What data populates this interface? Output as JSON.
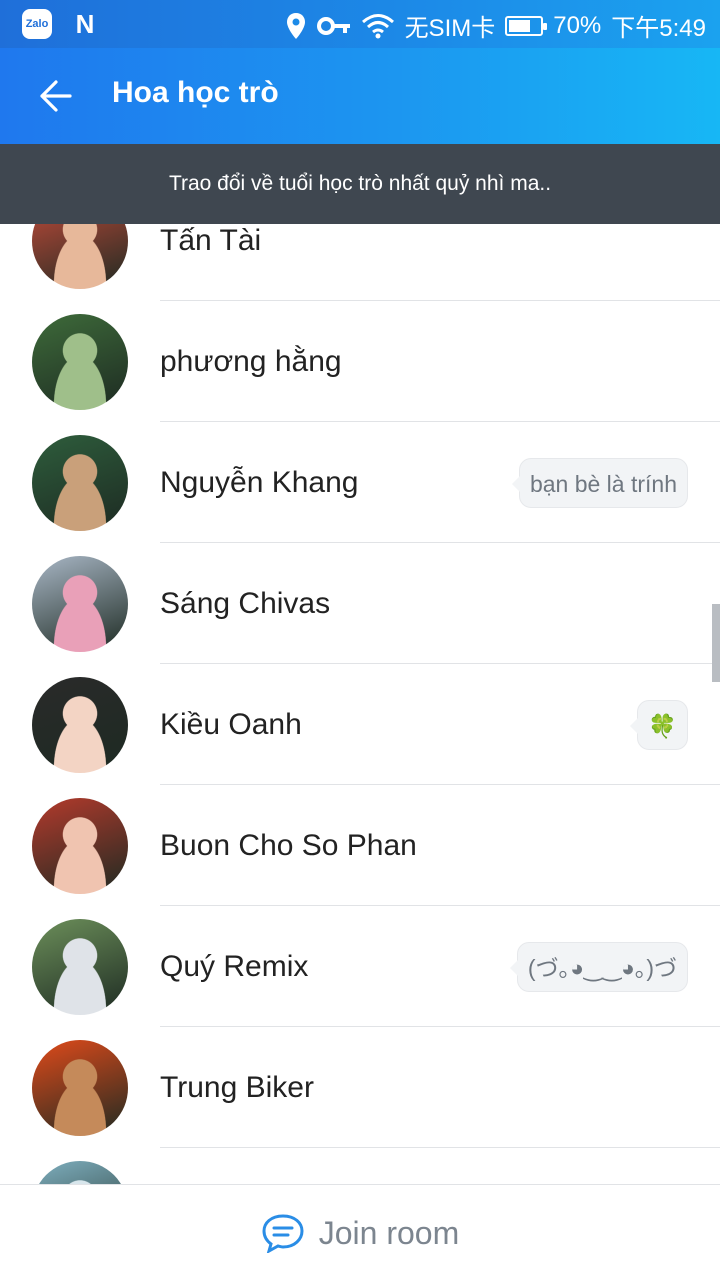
{
  "status_bar": {
    "left_icons": [
      "zalo-icon",
      "n-icon"
    ],
    "zalo_label": "Zalo",
    "n_label": "N",
    "sim": "无SIM卡",
    "battery": "70%",
    "battery_level": 0.7,
    "time": "下午5:49"
  },
  "header": {
    "title": "Hoa học trò",
    "back_icon": "arrow-left-icon"
  },
  "banner": {
    "text": "Trao đổi về tuổi học trò nhất quỷ nhì ma.."
  },
  "members": [
    {
      "name": "Tấn Tài",
      "status": ""
    },
    {
      "name": "phương hằng",
      "status": ""
    },
    {
      "name": "Nguyễn Khang",
      "status": "bạn bè là trính"
    },
    {
      "name": "Sáng Chivas",
      "status": ""
    },
    {
      "name": "Kiều Oanh",
      "status": "🍀"
    },
    {
      "name": "Buon Cho So Phan",
      "status": ""
    },
    {
      "name": "Quý Remix",
      "status": "(づ｡◕‿‿◕｡)づ"
    },
    {
      "name": "Trung Biker",
      "status": ""
    },
    {
      "name": "",
      "status": ""
    }
  ],
  "footer": {
    "join_label": "Join room",
    "icon": "chat-bubble-icon"
  },
  "colors": {
    "header_start": "#1f78ee",
    "header_end": "#17b7f5",
    "banner": "#3f4750",
    "accent": "#2a8de6"
  }
}
